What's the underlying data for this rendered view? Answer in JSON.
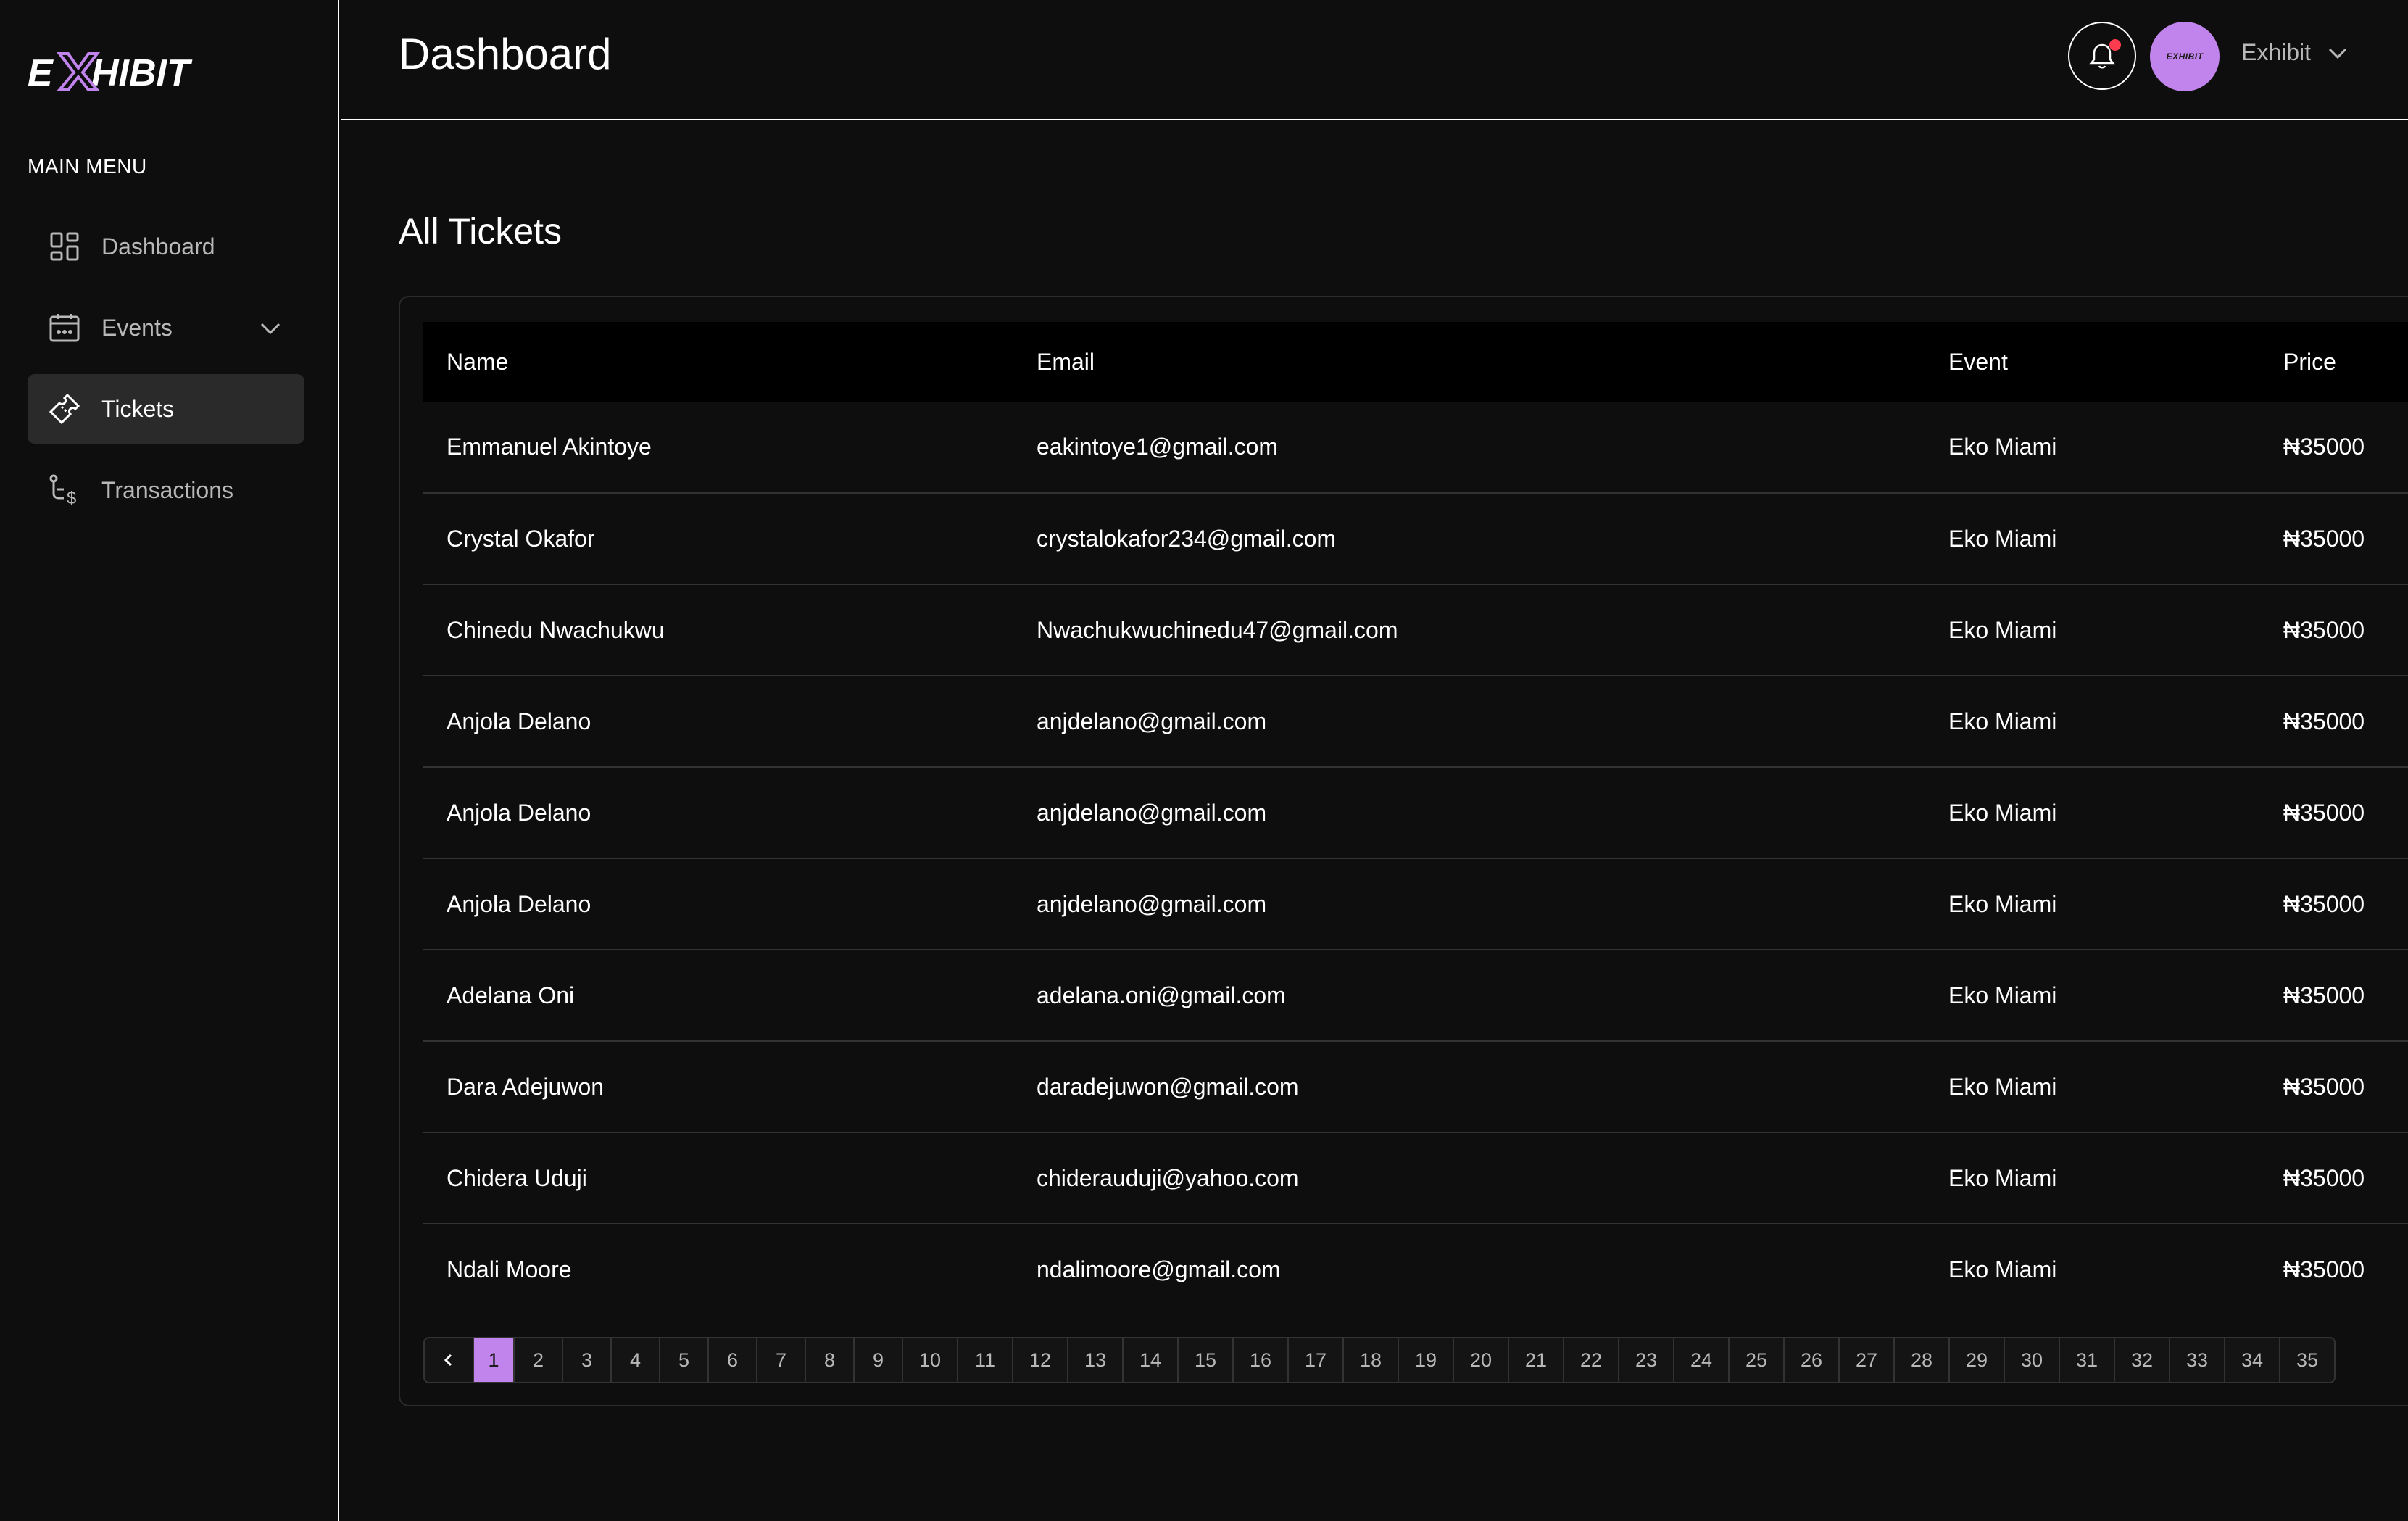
{
  "app": {
    "logo_text": "EXHIBIT",
    "accent_color": "#c183ec"
  },
  "sidebar": {
    "menu_heading": "MAIN MENU",
    "items": [
      {
        "label": "Dashboard",
        "icon": "grid-icon"
      },
      {
        "label": "Events",
        "icon": "calendar-icon"
      },
      {
        "label": "Tickets",
        "icon": "ticket-icon",
        "active": true
      },
      {
        "label": "Transactions",
        "icon": "transactions-icon"
      }
    ]
  },
  "header": {
    "title": "Dashboard",
    "avatar_text": "EXHIBIT",
    "user_name": "Exhibit"
  },
  "main": {
    "section_title": "All Tickets",
    "table": {
      "columns": [
        "Name",
        "Email",
        "Event",
        "Price"
      ],
      "rows": [
        [
          "Emmanuel Akintoye",
          "eakintoye1@gmail.com",
          "Eko Miami",
          "₦35000"
        ],
        [
          "Crystal Okafor",
          "crystalokafor234@gmail.com",
          "Eko Miami",
          "₦35000"
        ],
        [
          "Chinedu Nwachukwu",
          "Nwachukwuchinedu47@gmail.com",
          "Eko Miami",
          "₦35000"
        ],
        [
          "Anjola Delano",
          "anjdelano@gmail.com",
          "Eko Miami",
          "₦35000"
        ],
        [
          "Anjola Delano",
          "anjdelano@gmail.com",
          "Eko Miami",
          "₦35000"
        ],
        [
          "Anjola Delano",
          "anjdelano@gmail.com",
          "Eko Miami",
          "₦35000"
        ],
        [
          "Adelana Oni",
          "adelana.oni@gmail.com",
          "Eko Miami",
          "₦35000"
        ],
        [
          "Dara Adejuwon",
          "daradejuwon@gmail.com",
          "Eko Miami",
          "₦35000"
        ],
        [
          "Chidera Uduji",
          "chiderauduji@yahoo.com",
          "Eko Miami",
          "₦35000"
        ],
        [
          "Ndali Moore",
          "ndalimoore@gmail.com",
          "Eko Miami",
          "₦35000"
        ]
      ]
    },
    "pagination": {
      "current": "1",
      "pages": [
        "1",
        "2",
        "3",
        "4",
        "5",
        "6",
        "7",
        "8",
        "9",
        "10",
        "11",
        "12",
        "13",
        "14",
        "15",
        "16",
        "17",
        "18",
        "19",
        "20",
        "21",
        "22",
        "23",
        "24",
        "25",
        "26",
        "27",
        "28",
        "29",
        "30",
        "31",
        "32",
        "33",
        "34",
        "35"
      ]
    }
  }
}
